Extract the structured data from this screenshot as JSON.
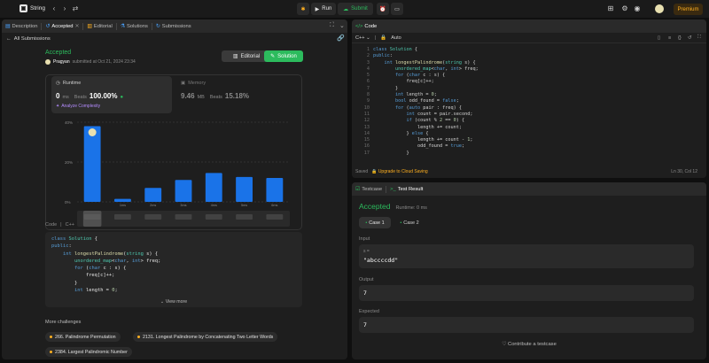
{
  "app": {
    "title": "String",
    "run_label": "Run",
    "submit_label": "Submit",
    "premium_label": "Premium"
  },
  "left_tabs": {
    "description": "Description",
    "accepted": "Accepted",
    "editorial": "Editorial",
    "solutions": "Solutions",
    "submissions": "Submissions"
  },
  "back_label": "All Submissions",
  "result": {
    "status": "Accepted",
    "user": "Pragyan",
    "submitted": "submitted at Oct 21, 2024 23:34",
    "editorial_btn": "Editorial",
    "solution_btn": "Solution"
  },
  "runtime": {
    "title": "Runtime",
    "value": "0",
    "unit": "ms",
    "beats_label": "Beats",
    "beats": "100.00%",
    "analyze": "Analyze Complexity"
  },
  "memory": {
    "title": "Memory",
    "value": "9.46",
    "unit": "MB",
    "beats_label": "Beats",
    "beats": "15.18%"
  },
  "chart_data": {
    "type": "bar",
    "y_ticks": [
      "40%",
      "20%",
      "0%"
    ],
    "ylim": [
      0,
      40
    ],
    "categories": [
      "0ms",
      "1ms",
      "2ms",
      "3ms",
      "4ms",
      "5ms",
      "6ms"
    ],
    "values": [
      38,
      1.5,
      7,
      11,
      14.5,
      12.5,
      12
    ],
    "highlight_index": 0,
    "bar_color": "#1a73e8",
    "grid": true
  },
  "code_section": {
    "label": "Code",
    "lang": "C++",
    "view_more": "View more"
  },
  "preview_code": [
    "class Solution {",
    "public:",
    "    int longestPalindrome(string s) {",
    "        unordered_map<char, int> freq;",
    "        for (char c : s) {",
    "            freq[c]++;",
    "        }",
    "        int length = 0;"
  ],
  "more": {
    "title": "More challenges",
    "items": [
      "266. Palindrome Permutation",
      "2131. Longest Palindrome by Concatenating Two Letter Words",
      "2384. Largest Palindromic Number"
    ]
  },
  "code_panel": {
    "title": "Code",
    "lang": "C++",
    "mode": "Auto",
    "saved": "Saved",
    "upgrade": "Upgrade to Cloud Saving",
    "cursor": "Ln 30, Col 12"
  },
  "editor_lines": [
    "class Solution {",
    "public:",
    "    int longestPalindrome(string s) {",
    "        unordered_map<char, int> freq;",
    "        for (char c : s) {",
    "            freq[c]++;",
    "        }",
    "        int length = 0;",
    "        bool odd_found = false;",
    "        for (auto pair : freq) {",
    "            int count = pair.second;",
    "            if (count % 2 == 0) {",
    "                length += count;",
    "            } else {",
    "                length += count - 1;",
    "                odd_found = true;",
    "            }"
  ],
  "test": {
    "testcase_tab": "Testcase",
    "result_tab": "Test Result",
    "status": "Accepted",
    "runtime": "Runtime: 0 ms",
    "case1": "Case 1",
    "case2": "Case 2",
    "input_label": "Input",
    "var": "s =",
    "input_value": "\"abccccdd\"",
    "output_label": "Output",
    "output_value": "7",
    "expected_label": "Expected",
    "expected_value": "7",
    "contribute": "Contribute a testcase"
  }
}
